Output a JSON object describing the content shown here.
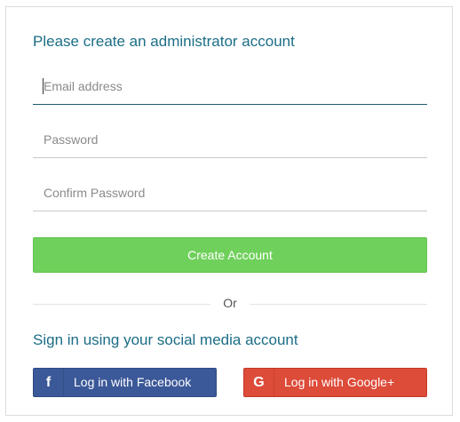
{
  "form": {
    "title": "Please create an administrator account",
    "email_placeholder": "Email address",
    "password_placeholder": "Password",
    "confirm_placeholder": "Confirm Password",
    "create_label": "Create Account",
    "or_label": "Or"
  },
  "social": {
    "title": "Sign in using your social media account",
    "facebook_label": "Log in with Facebook",
    "facebook_icon": "f",
    "google_label": "Log in with Google+",
    "google_icon": "G"
  },
  "colors": {
    "heading": "#1b6d86",
    "create_button": "#6fd05b",
    "facebook": "#3b5898",
    "google": "#dd4b39"
  }
}
